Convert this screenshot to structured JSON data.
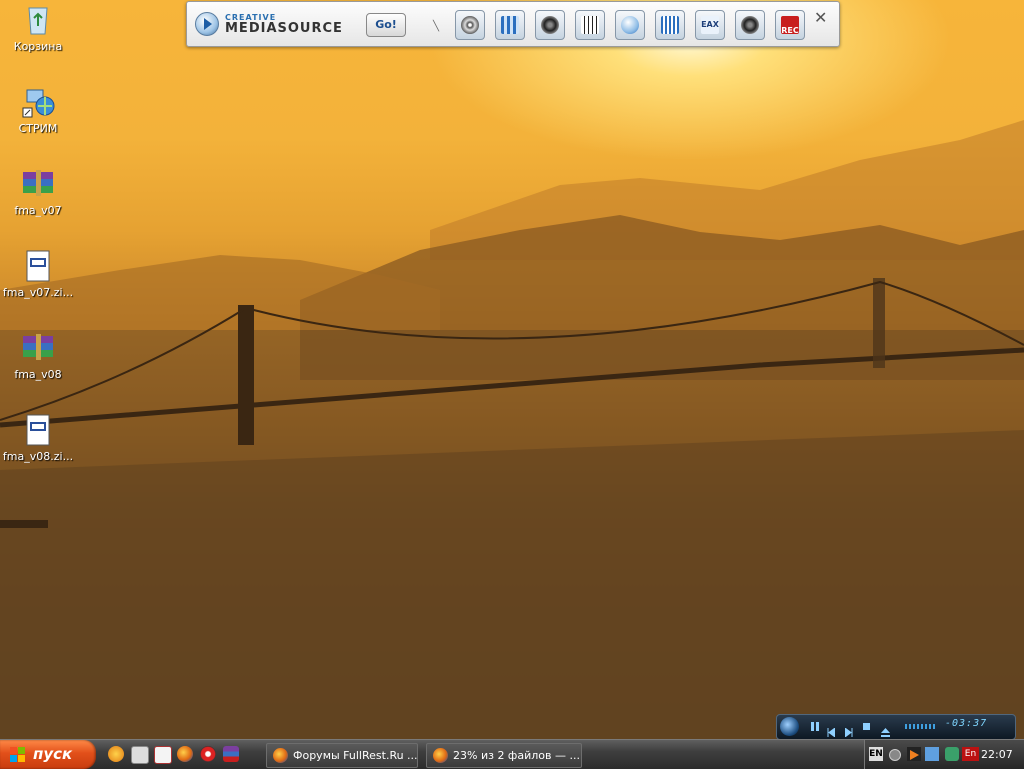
{
  "desktop": {
    "icons": [
      {
        "label": "Корзина",
        "icon": "recycle-bin-icon"
      },
      {
        "label": "СТРИМ",
        "icon": "network-connection-icon"
      },
      {
        "label": "fma_v07",
        "icon": "winrar-archive-icon"
      },
      {
        "label": "fma_v07.zi...",
        "icon": "zip-file-icon"
      },
      {
        "label": "fma_v08",
        "icon": "winrar-archive-icon"
      },
      {
        "label": "fma_v08.zi...",
        "icon": "zip-file-icon"
      }
    ]
  },
  "mediasource": {
    "brand_small": "CREATIVE",
    "brand_large": "MEDIASOURCE",
    "go_label": "Go!",
    "buttons": [
      {
        "icon": "disc-sync-icon"
      },
      {
        "icon": "mixer-icon"
      },
      {
        "icon": "speaker-icon"
      },
      {
        "icon": "synth-keyboard-icon"
      },
      {
        "icon": "play-icon"
      },
      {
        "icon": "equalizer-icon"
      },
      {
        "icon": "eax-icon",
        "label": "EAX"
      },
      {
        "icon": "speaker-settings-icon"
      },
      {
        "icon": "record-icon",
        "label": "REC"
      }
    ],
    "colors": {
      "accent": "#2a6fb0",
      "record": "#c81e1e"
    }
  },
  "taskbar": {
    "start_label": "пуск",
    "tasks": [
      {
        "label": "Форумы FullRest.Ru ...",
        "icon": "firefox-icon"
      },
      {
        "label": "23% из 2 файлов — ...",
        "icon": "firefox-icon"
      }
    ],
    "tray": {
      "language": "EN",
      "language_alt": "En",
      "clock": "22:07"
    }
  },
  "mini_player": {
    "time": "-03:37"
  }
}
